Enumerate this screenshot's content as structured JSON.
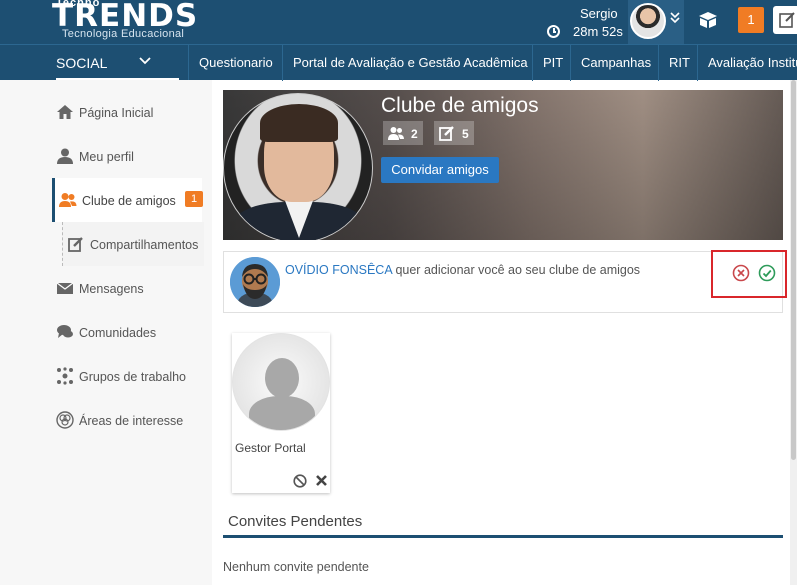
{
  "header": {
    "logo_top": "Techno",
    "logo_main": "TRENDS",
    "logo_tagline": "Tecnologia Educacional",
    "user_name": "Sergio",
    "session_timer": "28m 52s",
    "notification_count": "1"
  },
  "nav": {
    "section": "SOCIAL",
    "items": [
      "Questionario",
      "Portal de Avaliação e Gestão Acadêmica",
      "PIT",
      "Campanhas",
      "RIT",
      "Avaliação Institu"
    ]
  },
  "sidebar": {
    "items": [
      {
        "label": "Página Inicial",
        "icon": "home-icon"
      },
      {
        "label": "Meu perfil",
        "icon": "user-icon"
      },
      {
        "label": "Clube de amigos",
        "icon": "users-icon",
        "badge": "1"
      },
      {
        "label": "Compartilhamentos",
        "icon": "edit-icon"
      },
      {
        "label": "Mensagens",
        "icon": "envelope-icon"
      },
      {
        "label": "Comunidades",
        "icon": "comments-icon"
      },
      {
        "label": "Grupos de trabalho",
        "icon": "network-icon"
      },
      {
        "label": "Áreas de interesse",
        "icon": "interest-icon"
      }
    ]
  },
  "profile": {
    "title": "Clube de amigos",
    "friends_count": "2",
    "shares_count": "5",
    "invite_label": "Convidar amigos"
  },
  "request": {
    "requester": "OVÍDIO FONSÊCA",
    "message": "quer adicionar você ao seu clube de amigos"
  },
  "friends": [
    {
      "name": "Gestor Portal"
    }
  ],
  "pending": {
    "title": "Convites Pendentes",
    "empty": "Nenhum convite pendente"
  },
  "colors": {
    "header_bg": "#1d4f72",
    "accent_orange": "#f07c24",
    "link_blue": "#2a78c2",
    "highlight_red": "#d9262b",
    "accept_green": "#2e9b5a",
    "reject_red": "#c9474b"
  }
}
